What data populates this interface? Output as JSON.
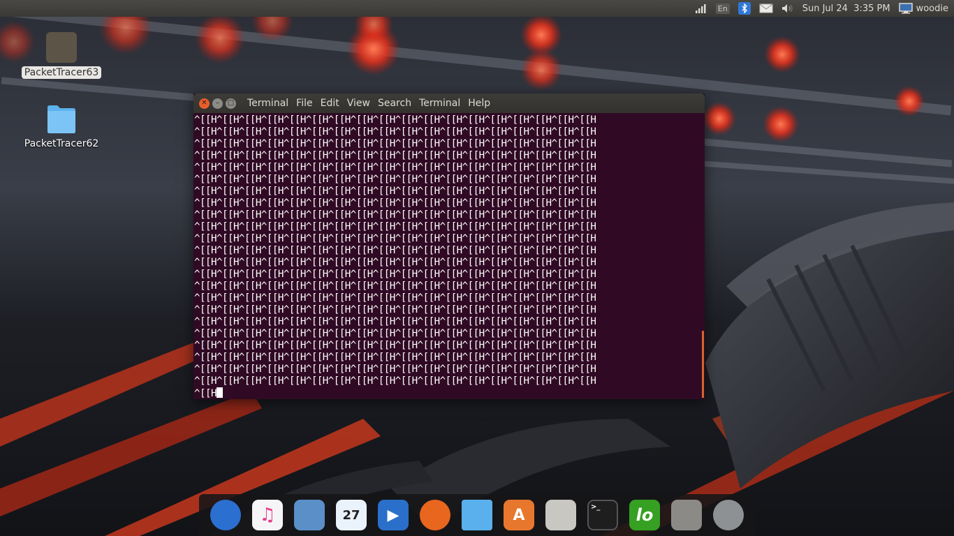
{
  "top_panel": {
    "language": "En",
    "datetime": "Sun Jul 24  3:35 PM",
    "username": "woodie",
    "icons": [
      "network-signal-icon",
      "keyboard-language-icon",
      "bluetooth-icon",
      "mail-icon",
      "volume-icon",
      "computer-icon"
    ]
  },
  "desktop": {
    "icons": [
      {
        "label": "PacketTracer63",
        "icon": "packettracer-icon"
      },
      {
        "label": "PacketTracer62",
        "icon": "folder-icon"
      }
    ]
  },
  "terminal": {
    "title": "Terminal",
    "menu": [
      "File",
      "Edit",
      "View",
      "Search",
      "Terminal",
      "Help"
    ],
    "lines": [
      "^[[H^[[H^[[H^[[H^[[H^[[H^[[H^[[H^[[H^[[H^[[H^[[H^[[H^[[H^[[H^[[H^[[H^[[H",
      "^[[H^[[H^[[H^[[H^[[H^[[H^[[H^[[H^[[H^[[H^[[H^[[H^[[H^[[H^[[H^[[H^[[H^[[H",
      "^[[H^[[H^[[H^[[H^[[H^[[H^[[H^[[H^[[H^[[H^[[H^[[H^[[H^[[H^[[H^[[H^[[H^[[H",
      "^[[H^[[H^[[H^[[H^[[H^[[H^[[H^[[H^[[H^[[H^[[H^[[H^[[H^[[H^[[H^[[H^[[H^[[H",
      "^[[H^[[H^[[H^[[H^[[H^[[H^[[H^[[H^[[H^[[H^[[H^[[H^[[H^[[H^[[H^[[H^[[H^[[H",
      "^[[H^[[H^[[H^[[H^[[H^[[H^[[H^[[H^[[H^[[H^[[H^[[H^[[H^[[H^[[H^[[H^[[H^[[H",
      "^[[H^[[H^[[H^[[H^[[H^[[H^[[H^[[H^[[H^[[H^[[H^[[H^[[H^[[H^[[H^[[H^[[H^[[H",
      "^[[H^[[H^[[H^[[H^[[H^[[H^[[H^[[H^[[H^[[H^[[H^[[H^[[H^[[H^[[H^[[H^[[H^[[H",
      "^[[H^[[H^[[H^[[H^[[H^[[H^[[H^[[H^[[H^[[H^[[H^[[H^[[H^[[H^[[H^[[H^[[H^[[H",
      "^[[H^[[H^[[H^[[H^[[H^[[H^[[H^[[H^[[H^[[H^[[H^[[H^[[H^[[H^[[H^[[H^[[H^[[H",
      "^[[H^[[H^[[H^[[H^[[H^[[H^[[H^[[H^[[H^[[H^[[H^[[H^[[H^[[H^[[H^[[H^[[H^[[H",
      "^[[H^[[H^[[H^[[H^[[H^[[H^[[H^[[H^[[H^[[H^[[H^[[H^[[H^[[H^[[H^[[H^[[H^[[H",
      "^[[H^[[H^[[H^[[H^[[H^[[H^[[H^[[H^[[H^[[H^[[H^[[H^[[H^[[H^[[H^[[H^[[H^[[H",
      "^[[H^[[H^[[H^[[H^[[H^[[H^[[H^[[H^[[H^[[H^[[H^[[H^[[H^[[H^[[H^[[H^[[H^[[H",
      "^[[H^[[H^[[H^[[H^[[H^[[H^[[H^[[H^[[H^[[H^[[H^[[H^[[H^[[H^[[H^[[H^[[H^[[H",
      "^[[H^[[H^[[H^[[H^[[H^[[H^[[H^[[H^[[H^[[H^[[H^[[H^[[H^[[H^[[H^[[H^[[H^[[H",
      "^[[H^[[H^[[H^[[H^[[H^[[H^[[H^[[H^[[H^[[H^[[H^[[H^[[H^[[H^[[H^[[H^[[H^[[H",
      "^[[H^[[H^[[H^[[H^[[H^[[H^[[H^[[H^[[H^[[H^[[H^[[H^[[H^[[H^[[H^[[H^[[H^[[H",
      "^[[H^[[H^[[H^[[H^[[H^[[H^[[H^[[H^[[H^[[H^[[H^[[H^[[H^[[H^[[H^[[H^[[H^[[H",
      "^[[H^[[H^[[H^[[H^[[H^[[H^[[H^[[H^[[H^[[H^[[H^[[H^[[H^[[H^[[H^[[H^[[H^[[H",
      "^[[H^[[H^[[H^[[H^[[H^[[H^[[H^[[H^[[H^[[H^[[H^[[H^[[H^[[H^[[H^[[H^[[H^[[H",
      "^[[H^[[H^[[H^[[H^[[H^[[H^[[H^[[H^[[H^[[H^[[H^[[H^[[H^[[H^[[H^[[H^[[H^[[H",
      "^[[H^[[H^[[H^[[H^[[H^[[H^[[H^[[H^[[H^[[H^[[H^[[H^[[H^[[H^[[H^[[H^[[H^[[H",
      "^[[H"
    ]
  },
  "dock": {
    "items": [
      {
        "icon": "thunderbird-mail-icon",
        "color": "#2b6fd1"
      },
      {
        "icon": "music-player-icon",
        "color": "#f5f5f7"
      },
      {
        "icon": "image-viewer-icon",
        "color": "#5b8fc7"
      },
      {
        "icon": "calendar-icon",
        "color": "#eaf2fb",
        "text": "27"
      },
      {
        "icon": "media-player-icon",
        "color": "#2a6fc9"
      },
      {
        "icon": "firefox-icon",
        "color": "#e8661e"
      },
      {
        "icon": "files-icon",
        "color": "#5ab0ec"
      },
      {
        "icon": "software-center-icon",
        "color": "#e8772e"
      },
      {
        "icon": "system-settings-mixer-icon",
        "color": "#c9c7c2"
      },
      {
        "icon": "terminal-icon",
        "color": "#1e1e1e"
      },
      {
        "icon": "libreoffice-icon",
        "color": "#36a022",
        "text": "lo"
      },
      {
        "icon": "calculator-icon",
        "color": "#8c8a86"
      },
      {
        "icon": "system-preferences-icon",
        "color": "#8e9194"
      }
    ]
  },
  "colors": {
    "terminal_bg": "#300a24",
    "accent": "#e85e2b",
    "panel_bg": "#3d3c38"
  }
}
